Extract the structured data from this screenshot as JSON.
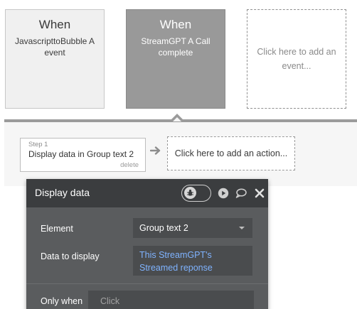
{
  "events": [
    {
      "when": "When",
      "name": "JavascripttoBubble A event",
      "selected": false
    },
    {
      "when": "When",
      "name": "StreamGPT A Call complete",
      "selected": true
    }
  ],
  "add_event_label": "Click here to add an event...",
  "step": {
    "number": "Step 1",
    "title": "Display data in Group text 2",
    "delete_label": "delete"
  },
  "add_action_label": "Click here to add an action...",
  "editor": {
    "title": "Display data",
    "header_icons": [
      "breakpoint-toggle-icon",
      "play-icon",
      "comment-icon",
      "close-icon"
    ],
    "element_label": "Element",
    "element_value": "Group text 2",
    "data_label": "Data to display",
    "data_value": "This StreamGPT's Streamed reponse",
    "only_when_label": "Only when",
    "only_when_placeholder": "Click"
  }
}
